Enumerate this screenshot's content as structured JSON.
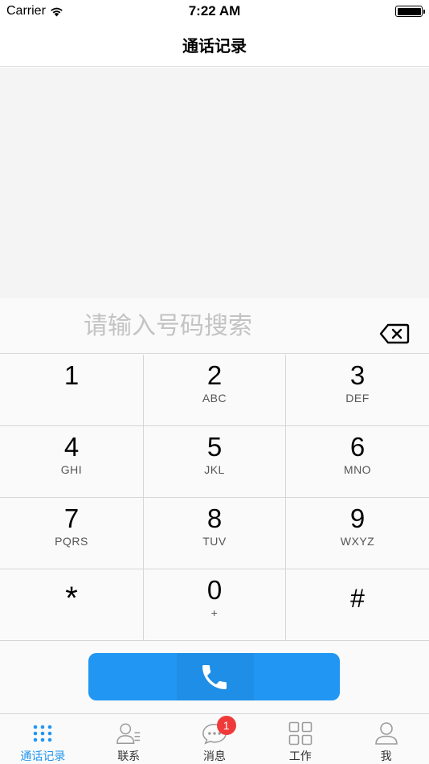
{
  "status_bar": {
    "carrier": "Carrier",
    "time": "7:22 AM"
  },
  "nav": {
    "title": "通话记录"
  },
  "dialer": {
    "placeholder": "请输入号码搜索",
    "value": ""
  },
  "keypad": {
    "keys": [
      {
        "digit": "1",
        "letters": ""
      },
      {
        "digit": "2",
        "letters": "ABC"
      },
      {
        "digit": "3",
        "letters": "DEF"
      },
      {
        "digit": "4",
        "letters": "GHI"
      },
      {
        "digit": "5",
        "letters": "JKL"
      },
      {
        "digit": "6",
        "letters": "MNO"
      },
      {
        "digit": "7",
        "letters": "PQRS"
      },
      {
        "digit": "8",
        "letters": "TUV"
      },
      {
        "digit": "9",
        "letters": "WXYZ"
      },
      {
        "digit": "*",
        "letters": ""
      },
      {
        "digit": "0",
        "letters": "+"
      },
      {
        "digit": "#",
        "letters": ""
      }
    ]
  },
  "colors": {
    "accent": "#2196f3",
    "badge": "#f03a3a",
    "tab_inactive": "#9b9b9b"
  },
  "tabs": [
    {
      "label": "通话记录",
      "icon": "dialpad-icon",
      "active": true
    },
    {
      "label": "联系",
      "icon": "contacts-icon",
      "active": false
    },
    {
      "label": "消息",
      "icon": "message-icon",
      "active": false,
      "badge": "1"
    },
    {
      "label": "工作",
      "icon": "apps-grid-icon",
      "active": false
    },
    {
      "label": "我",
      "icon": "profile-icon",
      "active": false
    }
  ]
}
